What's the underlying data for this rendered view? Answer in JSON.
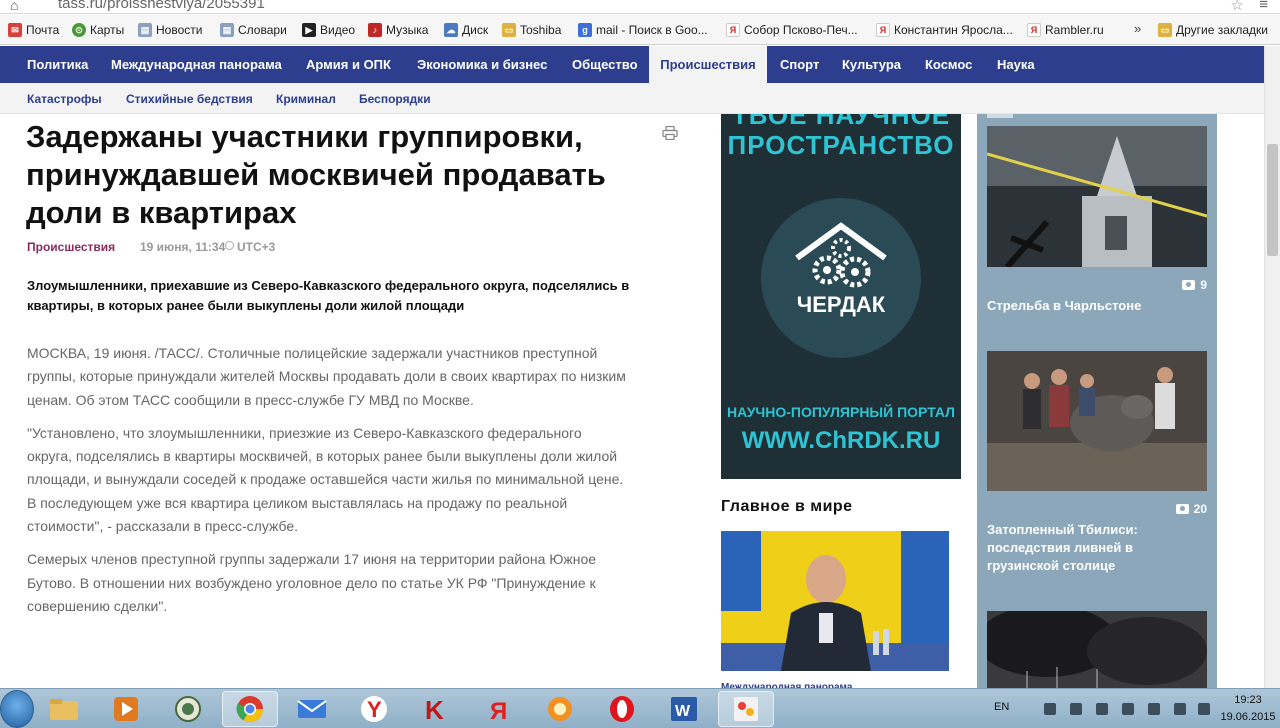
{
  "browser": {
    "url": "tass.ru/proisshestviya/2055391",
    "bookmarks": [
      {
        "label": "Почта",
        "icon": "mail-icon",
        "color": "#d8403a"
      },
      {
        "label": "Карты",
        "icon": "maps-icon",
        "color": "#4a9a3a"
      },
      {
        "label": "Новости",
        "icon": "page-icon",
        "color": "#8aa0c0"
      },
      {
        "label": "Словари",
        "icon": "page-icon",
        "color": "#8aa0c0"
      },
      {
        "label": "Видео",
        "icon": "video-icon",
        "color": "#222222"
      },
      {
        "label": "Музыка",
        "icon": "music-icon",
        "color": "#c02828"
      },
      {
        "label": "Диск",
        "icon": "disk-icon",
        "color": "#4a7ac0"
      },
      {
        "label": "Toshiba",
        "icon": "folder-icon",
        "color": "#e0b040"
      },
      {
        "label": "mail - Поиск в Goo...",
        "icon": "google-icon",
        "color": "#3b6fd9"
      },
      {
        "label": "Собор Псково-Печ...",
        "icon": "yandex-icon",
        "color": "#ffffff"
      },
      {
        "label": "Константин Яросла...",
        "icon": "yandex-icon",
        "color": "#ffffff"
      },
      {
        "label": "Rambler.ru",
        "icon": "yandex-icon",
        "color": "#ffffff"
      }
    ],
    "more": "»",
    "other_bookmarks": "Другие закладки"
  },
  "nav": {
    "items": [
      "Политика",
      "Международная панорама",
      "Армия и ОПК",
      "Экономика и бизнес",
      "Общество",
      "Происшествия",
      "Спорт",
      "Культура",
      "Космос",
      "Наука"
    ],
    "active": "Происшествия",
    "sub": [
      "Катастрофы",
      "Стихийные бедствия",
      "Криминал",
      "Беспорядки"
    ]
  },
  "article": {
    "title": "Задержаны участники группировки, принуждавшей москвичей продавать доли в квартирах",
    "category": "Происшествия",
    "date": "19 июня, 11:34",
    "tz": "UTC+3",
    "lead": "Злоумышленники, приехавшие из Северо-Кавказского федерального округа, подселялись в квартиры, в которых ранее были выкуплены доли жилой площади",
    "paragraphs": [
      "МОСКВА, 19 июня. /ТАСС/. Столичные полицейские задержали участников преступной группы, которые принуждали жителей Москвы продавать доли в своих квартирах по низким ценам. Об этом ТАСС сообщили в пресс-службе ГУ МВД по Москве.",
      "\"Установлено, что злоумышленники, приезжие из Северо-Кавказского федерального округа, подселялись в квартиры москвичей, в которых ранее были выкуплены доли жилой площади, и вынуждали соседей к продаже оставшейся части жилья по минимальной цене. В последующем уже вся квартира целиком выставлялась на продажу по реальной стоимости\", - рассказали в пресс-службе.",
      "Семерых членов преступной группы задержали 17 июня на территории района Южное Бутово. В отношении них возбуждено уголовное дело по статье УК РФ \"Принуждение к совершению сделки\"."
    ]
  },
  "ad": {
    "line1": "ТВОЕ НАУЧНОЕ",
    "line2": "ПРОСТРАНСТВО",
    "brand": "ЧЕРДАК",
    "tagline": "НАУЧНО-ПОПУЛЯРНЫЙ ПОРТАЛ",
    "site": "WWW.ChRDK.RU"
  },
  "world": {
    "heading": "Главное в мире",
    "caption": "Международная панорама"
  },
  "gallery": [
    {
      "count": "9",
      "caption": "Стрельба в Чарльстоне"
    },
    {
      "count": "20",
      "caption": "Затопленный Тбилиси: последствия ливней в грузинской столице"
    },
    {
      "count": "",
      "caption": ""
    }
  ],
  "taskbar": {
    "lang": "EN",
    "time": "19:23",
    "date": "19.06.2015"
  }
}
